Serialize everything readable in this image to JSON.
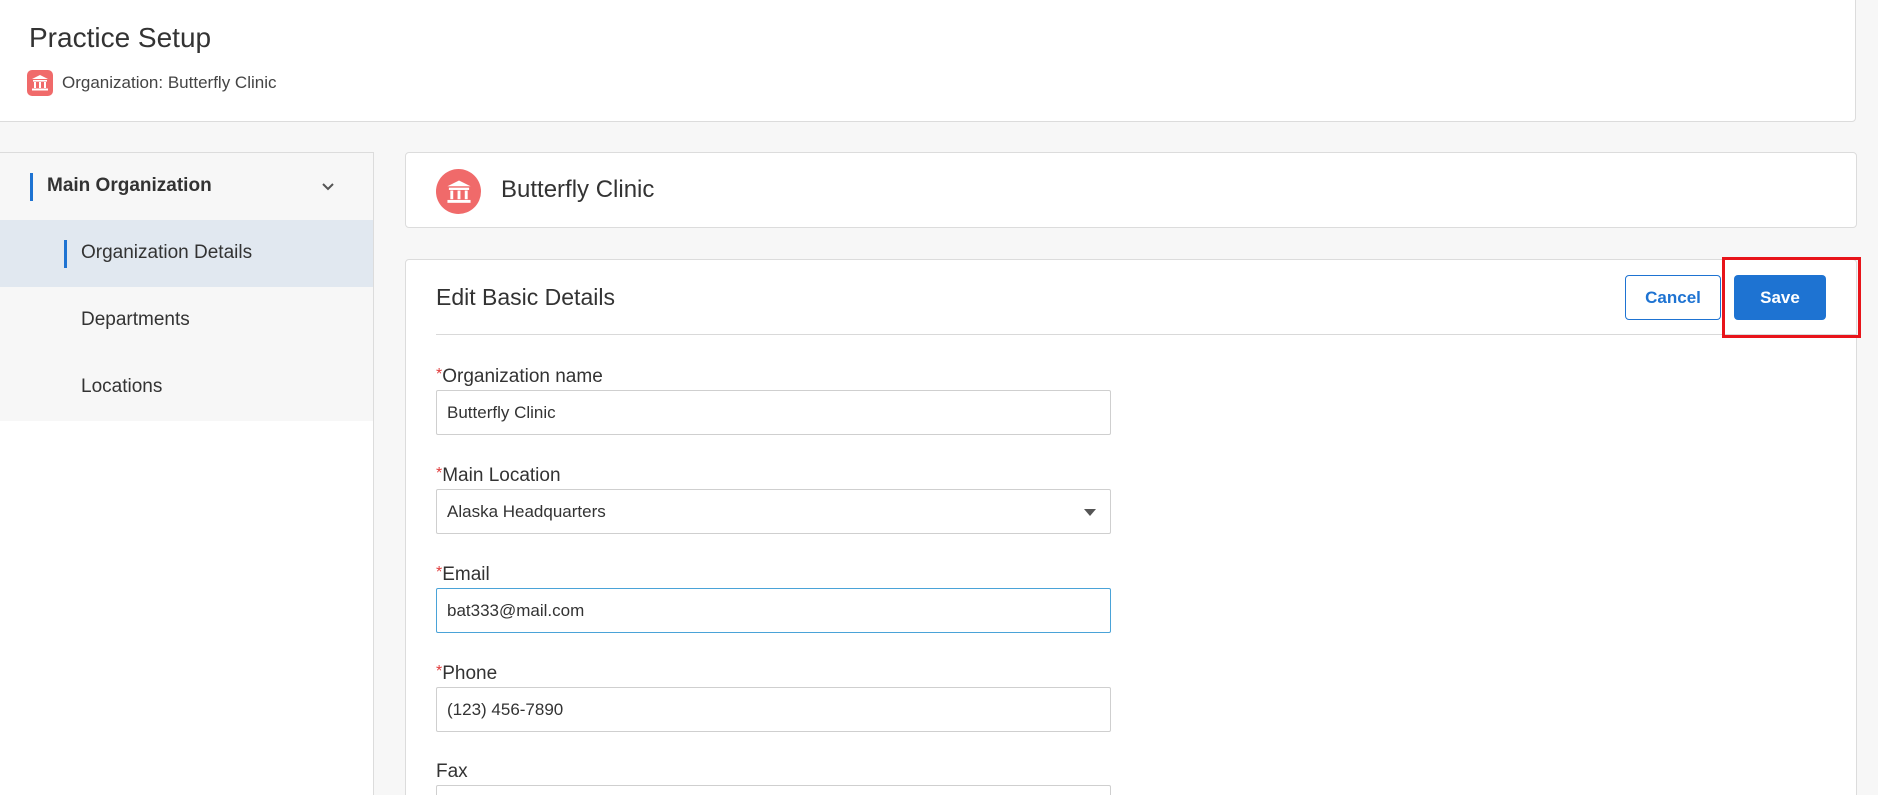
{
  "header": {
    "title": "Practice Setup",
    "organization_label": "Organization: Butterfly Clinic"
  },
  "sidebar": {
    "items": [
      {
        "label": "Main Organization"
      },
      {
        "label": "Organization Details"
      },
      {
        "label": "Departments"
      },
      {
        "label": "Locations"
      }
    ]
  },
  "banner": {
    "clinic_name": "Butterfly Clinic"
  },
  "edit": {
    "title": "Edit Basic Details",
    "cancel_label": "Cancel",
    "save_label": "Save"
  },
  "form": {
    "required_mark": "*",
    "org_name": {
      "label": "Organization name",
      "value": "Butterfly Clinic"
    },
    "main_location": {
      "label": "Main Location",
      "value": "Alaska Headquarters"
    },
    "email": {
      "label": "Email",
      "value": "bat333@mail.com"
    },
    "phone": {
      "label": "Phone",
      "value": "(123) 456-7890"
    },
    "fax": {
      "label": "Fax",
      "value": ""
    }
  },
  "colors": {
    "accent": "#1e73d2",
    "org_icon": "#f06a6a",
    "highlight": "#e8141a"
  },
  "icons": [
    "bank-icon",
    "chevron-down-icon",
    "dropdown-caret-icon"
  ]
}
